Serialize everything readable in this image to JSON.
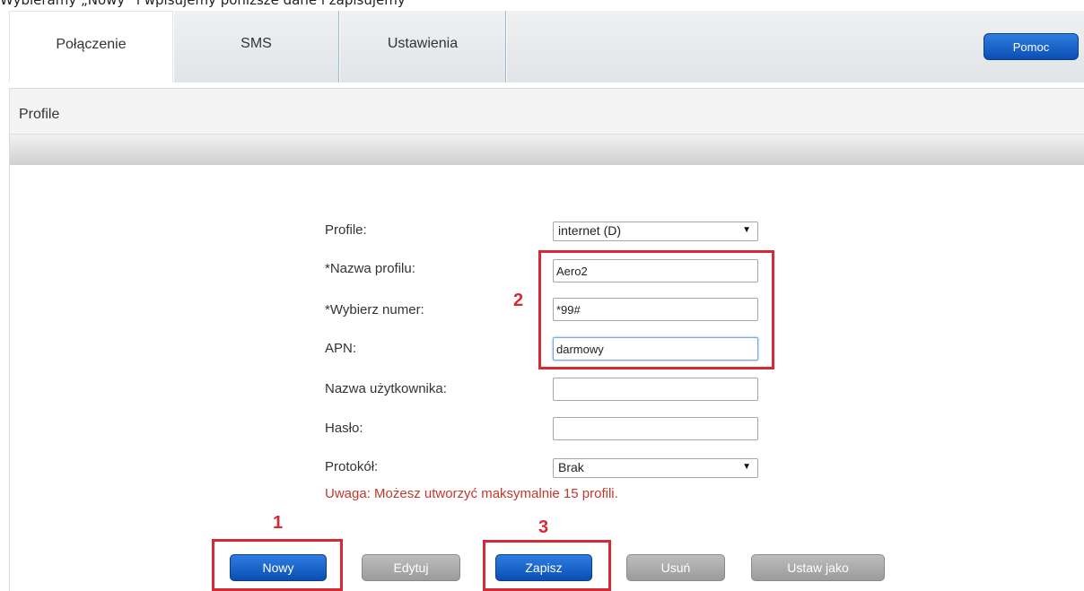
{
  "caption": "Wybieramy „Nowy” i wpisujemy poniższe dane i zapisujemy",
  "tabs": {
    "connection": "Połączenie",
    "sms": "SMS",
    "settings": "Ustawienia"
  },
  "help_button": "Pomoc",
  "panel": {
    "title": "Profile"
  },
  "form": {
    "profile_label": "Profile:",
    "profile_value": "internet (D)",
    "profile_name_label": "*Nazwa profilu:",
    "profile_name_value": "Aero2",
    "dial_number_label": "*Wybierz numer:",
    "dial_number_value": "*99#",
    "apn_label": "APN:",
    "apn_value": "darmowy",
    "username_label": "Nazwa użytkownika:",
    "username_value": "",
    "password_label": "Hasło:",
    "password_value": "",
    "protocol_label": "Protokół:",
    "protocol_value": "Brak",
    "warning": "Uwaga: Możesz utworzyć maksymalnie 15 profili."
  },
  "buttons": {
    "new": "Nowy",
    "edit": "Edytuj",
    "save": "Zapisz",
    "delete": "Usuń",
    "set_as": "Ustaw jako"
  },
  "annotations": {
    "step1": "1",
    "step2": "2",
    "step3": "3"
  },
  "colors": {
    "accent_blue": "#0a4fb3",
    "annotation_red": "#d42a35",
    "warning_red": "#c0392b",
    "disabled_gray": "#a8a8a8"
  },
  "icons": {
    "dropdown": "dropdown-arrow-icon"
  }
}
